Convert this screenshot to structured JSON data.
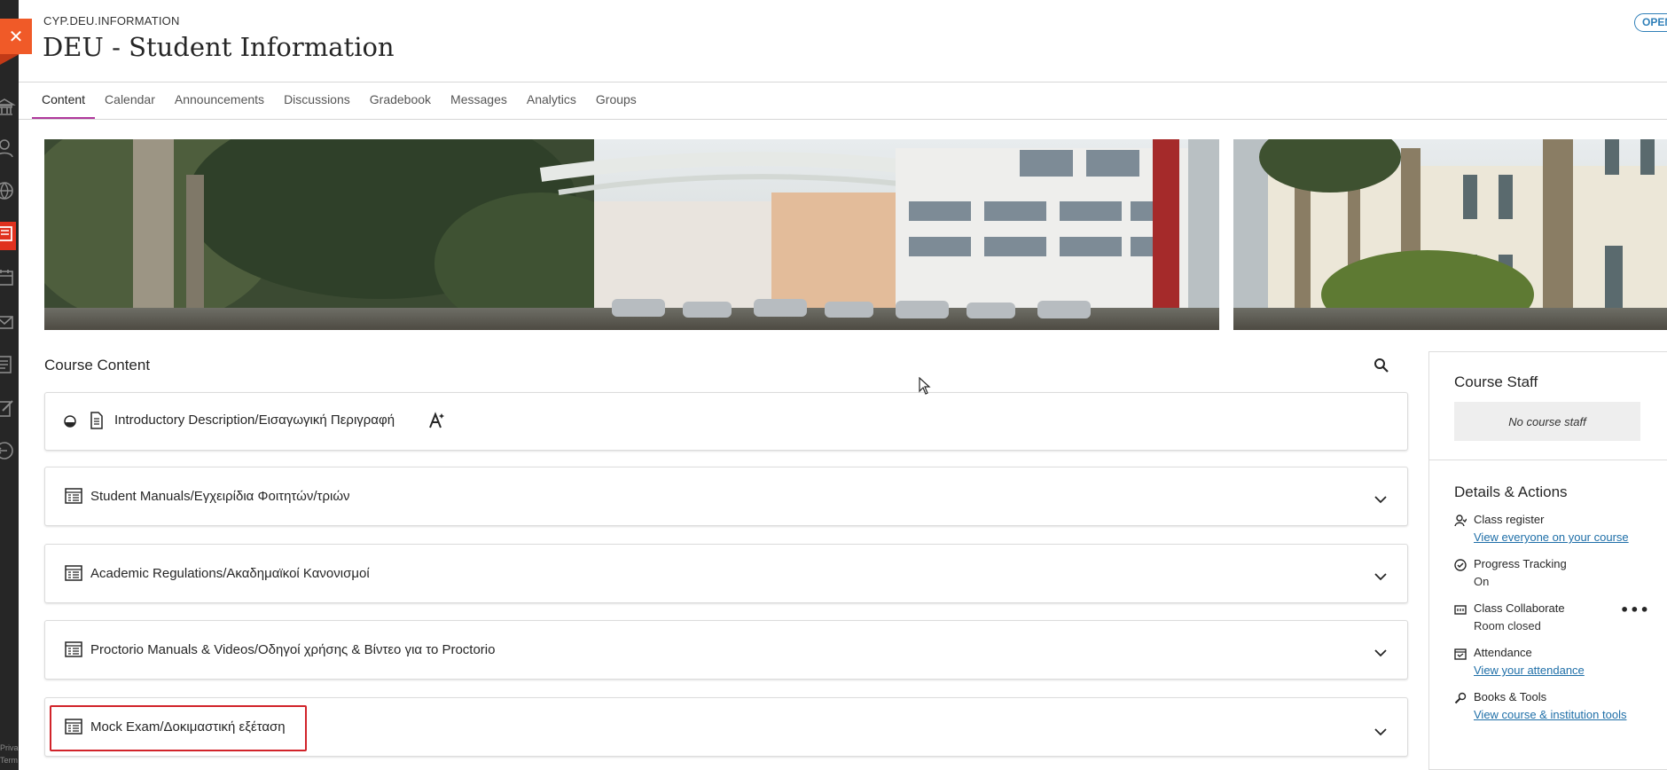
{
  "header": {
    "course_code": "CYP.DEU.INFORMATION",
    "course_title": "DEU - Student Information",
    "status_badge": "OPEN",
    "close_icon": "close-icon"
  },
  "tabs": [
    {
      "label": "Content",
      "active": true
    },
    {
      "label": "Calendar",
      "active": false
    },
    {
      "label": "Announcements",
      "active": false
    },
    {
      "label": "Discussions",
      "active": false
    },
    {
      "label": "Gradebook",
      "active": false
    },
    {
      "label": "Messages",
      "active": false
    },
    {
      "label": "Analytics",
      "active": false
    },
    {
      "label": "Groups",
      "active": false
    }
  ],
  "rail": {
    "icons": [
      "institution-icon",
      "profile-icon",
      "globe-icon",
      "courses-icon",
      "calendar-icon",
      "messages-icon",
      "grades-icon",
      "edit-icon",
      "sign-out-icon"
    ],
    "footer_line1": "Priva",
    "footer_line2": "Term"
  },
  "course_content": {
    "title": "Course Content",
    "items": [
      {
        "label": "Introductory Description/Εισαγωγική Περιγραφή",
        "icon": "document-icon",
        "expandable": false
      },
      {
        "label": "Student Manuals/Εγχειρίδια Φοιτητών/τριών",
        "icon": "folder-icon",
        "expandable": true
      },
      {
        "label": "Academic Regulations/Ακαδημαϊκοί Κανονισμοί",
        "icon": "folder-icon",
        "expandable": true
      },
      {
        "label": "Proctorio Manuals & Videos/Οδηγοί χρήσης & Βίντεο για το Proctorio",
        "icon": "folder-icon",
        "expandable": true
      },
      {
        "label": "Mock Exam/Δοκιμαστική εξέταση",
        "icon": "folder-icon",
        "expandable": true
      }
    ]
  },
  "side_panel": {
    "staff_title": "Course Staff",
    "no_staff": "No course staff",
    "details_title": "Details & Actions",
    "details": [
      {
        "name": "Class register",
        "value": "View everyone on your course",
        "link": true
      },
      {
        "name": "Progress Tracking",
        "value": "On",
        "link": false
      },
      {
        "name": "Class Collaborate",
        "value": "Room closed",
        "link": false
      },
      {
        "name": "Attendance",
        "value": "View your attendance",
        "link": true
      },
      {
        "name": "Books & Tools",
        "value": "View course & institution tools",
        "link": true
      }
    ]
  },
  "colors": {
    "accent_tab": "#b0389c",
    "close_button": "#f05a28",
    "link": "#1f6fa8",
    "highlight_box": "#d1232a"
  }
}
